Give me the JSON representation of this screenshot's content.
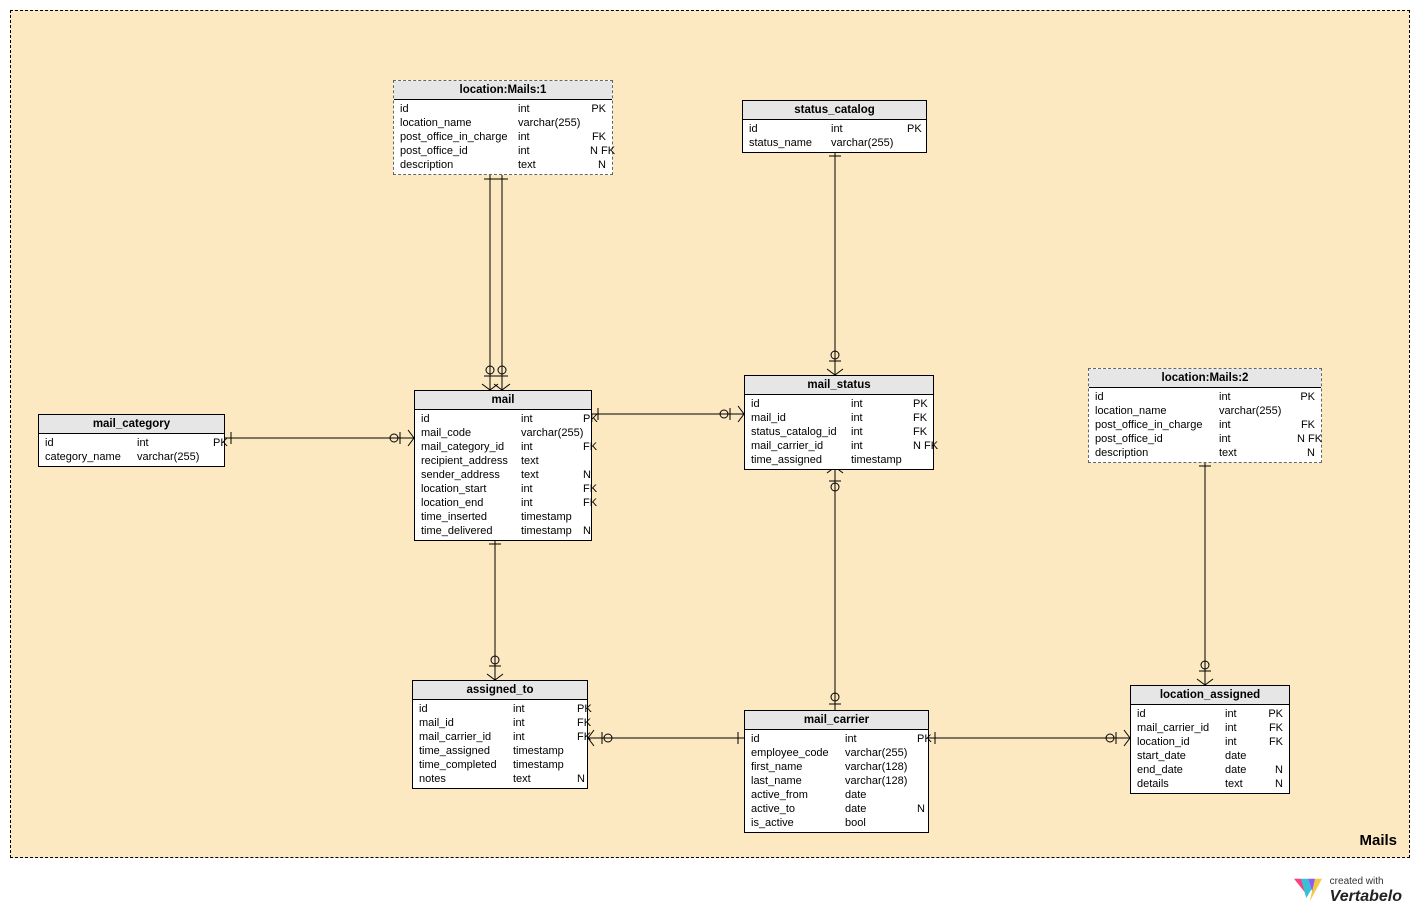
{
  "area_label": "Mails",
  "logo": {
    "small": "created with",
    "brand": "Vertabelo"
  },
  "entities": {
    "location1": {
      "title": "location:Mails:1",
      "cols": [
        [
          "id",
          "int",
          "PK"
        ],
        [
          "location_name",
          "varchar(255)",
          ""
        ],
        [
          "post_office_in_charge",
          "int",
          "FK"
        ],
        [
          "post_office_id",
          "int",
          "N FK"
        ],
        [
          "description",
          "text",
          "N"
        ]
      ]
    },
    "status_catalog": {
      "title": "status_catalog",
      "cols": [
        [
          "id",
          "int",
          "PK"
        ],
        [
          "status_name",
          "varchar(255)",
          ""
        ]
      ]
    },
    "mail_category": {
      "title": "mail_category",
      "cols": [
        [
          "id",
          "int",
          "PK"
        ],
        [
          "category_name",
          "varchar(255)",
          ""
        ]
      ]
    },
    "mail": {
      "title": "mail",
      "cols": [
        [
          "id",
          "int",
          "PK"
        ],
        [
          "mail_code",
          "varchar(255)",
          ""
        ],
        [
          "mail_category_id",
          "int",
          "FK"
        ],
        [
          "recipient_address",
          "text",
          ""
        ],
        [
          "sender_address",
          "text",
          "N"
        ],
        [
          "location_start",
          "int",
          "FK"
        ],
        [
          "location_end",
          "int",
          "FK"
        ],
        [
          "time_inserted",
          "timestamp",
          ""
        ],
        [
          "time_delivered",
          "timestamp",
          "N"
        ]
      ]
    },
    "mail_status": {
      "title": "mail_status",
      "cols": [
        [
          "id",
          "int",
          "PK"
        ],
        [
          "mail_id",
          "int",
          "FK"
        ],
        [
          "status_catalog_id",
          "int",
          "FK"
        ],
        [
          "mail_carrier_id",
          "int",
          "N FK"
        ],
        [
          "time_assigned",
          "timestamp",
          ""
        ]
      ]
    },
    "location2": {
      "title": "location:Mails:2",
      "cols": [
        [
          "id",
          "int",
          "PK"
        ],
        [
          "location_name",
          "varchar(255)",
          ""
        ],
        [
          "post_office_in_charge",
          "int",
          "FK"
        ],
        [
          "post_office_id",
          "int",
          "N FK"
        ],
        [
          "description",
          "text",
          "N"
        ]
      ]
    },
    "assigned_to": {
      "title": "assigned_to",
      "cols": [
        [
          "id",
          "int",
          "PK"
        ],
        [
          "mail_id",
          "int",
          "FK"
        ],
        [
          "mail_carrier_id",
          "int",
          "FK"
        ],
        [
          "time_assigned",
          "timestamp",
          ""
        ],
        [
          "time_completed",
          "timestamp",
          ""
        ],
        [
          "notes",
          "text",
          "N"
        ]
      ]
    },
    "mail_carrier": {
      "title": "mail_carrier",
      "cols": [
        [
          "id",
          "int",
          "PK"
        ],
        [
          "employee_code",
          "varchar(255)",
          ""
        ],
        [
          "first_name",
          "varchar(128)",
          ""
        ],
        [
          "last_name",
          "varchar(128)",
          ""
        ],
        [
          "active_from",
          "date",
          ""
        ],
        [
          "active_to",
          "date",
          "N"
        ],
        [
          "is_active",
          "bool",
          ""
        ]
      ]
    },
    "location_assigned": {
      "title": "location_assigned",
      "cols": [
        [
          "id",
          "int",
          "PK"
        ],
        [
          "mail_carrier_id",
          "int",
          "FK"
        ],
        [
          "location_id",
          "int",
          "FK"
        ],
        [
          "start_date",
          "date",
          ""
        ],
        [
          "end_date",
          "date",
          "N"
        ],
        [
          "details",
          "text",
          "N"
        ]
      ]
    }
  }
}
